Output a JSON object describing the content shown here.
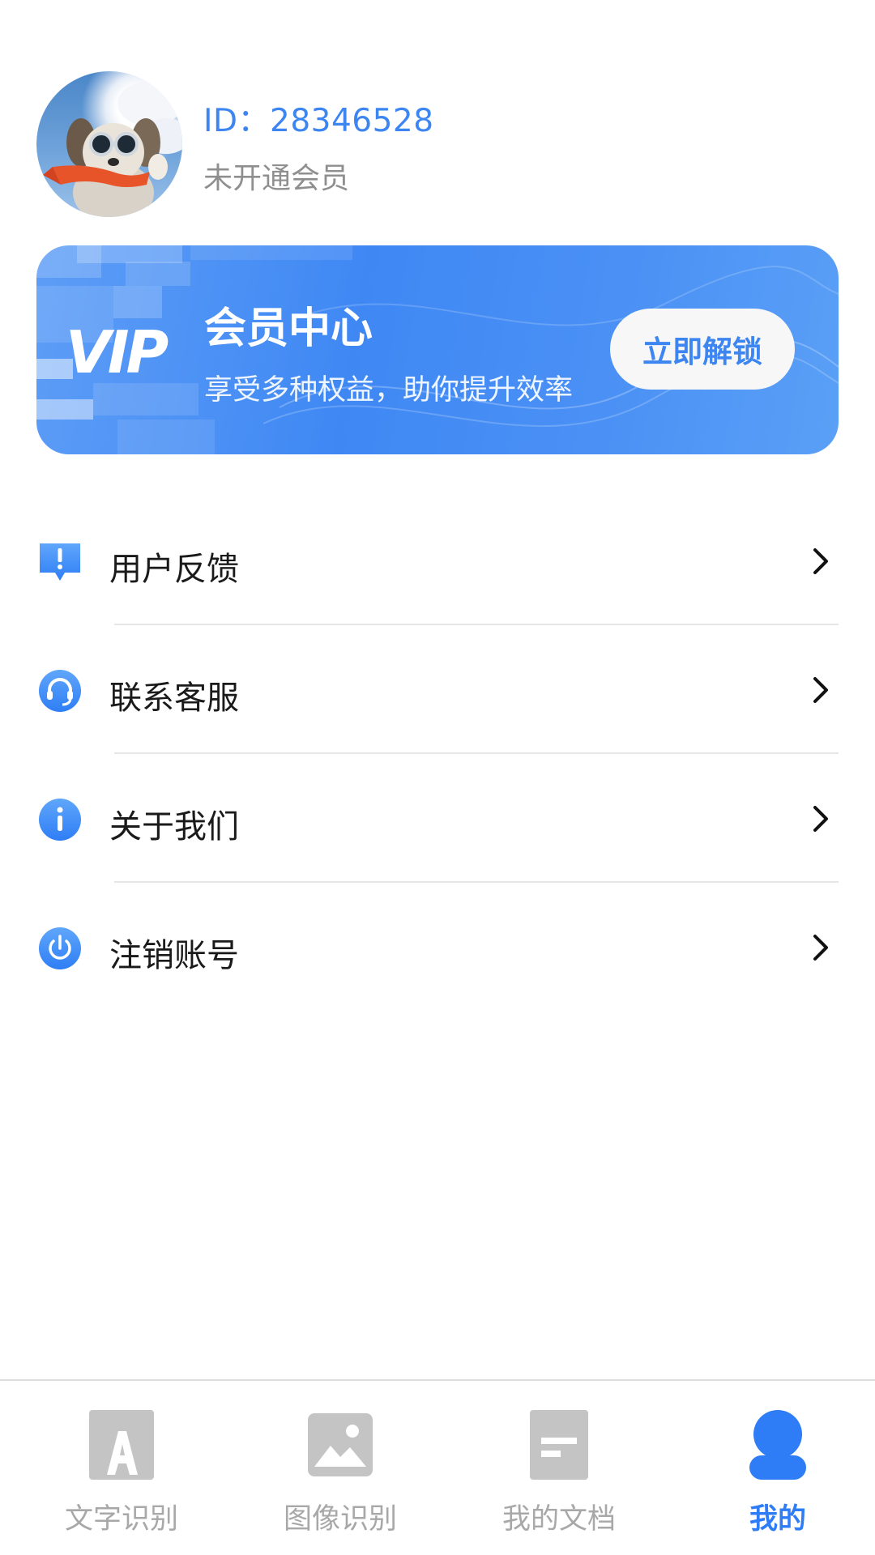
{
  "profile": {
    "id_text": "ID：28346528",
    "member_status": "未开通会员"
  },
  "vip_card": {
    "logo": "VIP",
    "title": "会员中心",
    "subtitle": "享受多种权益，助你提升效率",
    "button_label": "立即解锁"
  },
  "menu": {
    "items": [
      {
        "label": "用户反馈",
        "icon": "feedback-icon"
      },
      {
        "label": "联系客服",
        "icon": "headset-icon"
      },
      {
        "label": "关于我们",
        "icon": "info-icon"
      },
      {
        "label": "注销账号",
        "icon": "power-icon"
      }
    ]
  },
  "tabbar": {
    "tabs": [
      {
        "label": "文字识别",
        "icon": "text-recognition-icon",
        "active": false
      },
      {
        "label": "图像识别",
        "icon": "image-recognition-icon",
        "active": false
      },
      {
        "label": "我的文档",
        "icon": "document-icon",
        "active": false
      },
      {
        "label": "我的",
        "icon": "user-icon",
        "active": true
      }
    ]
  },
  "colors": {
    "accent": "#3d86f2",
    "inactive_tab": "#a8a8a8",
    "banner": "#4a8ff5"
  }
}
